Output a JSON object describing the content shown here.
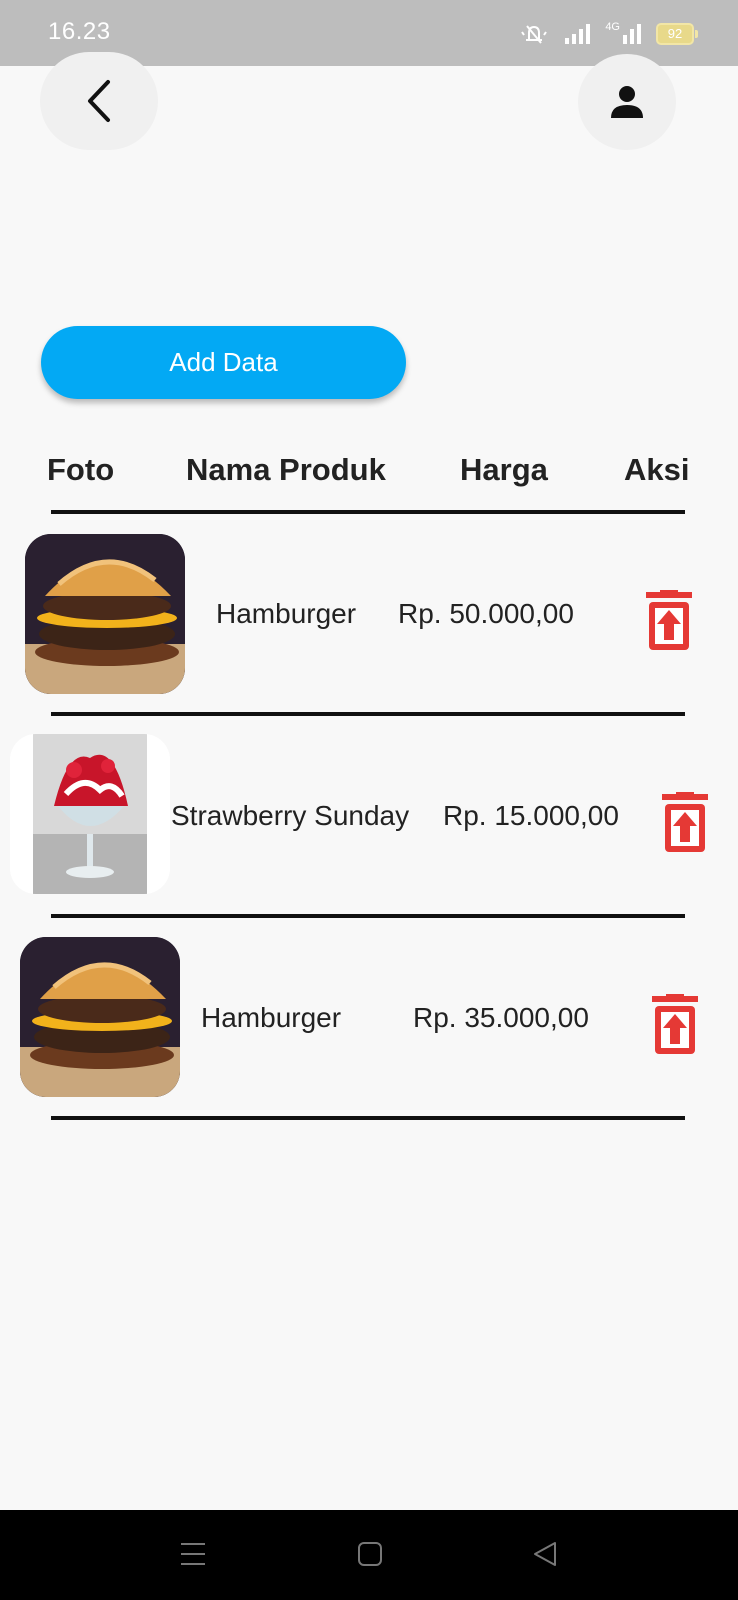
{
  "status_bar": {
    "time": "16.23",
    "battery": "92",
    "network": "4G"
  },
  "header": {
    "back_icon": "chevron-left-icon",
    "profile_icon": "person-icon"
  },
  "actions": {
    "add_label": "Add Data"
  },
  "table": {
    "headers": [
      "Foto",
      "Nama Produk",
      "Harga",
      "Aksi"
    ],
    "rows": [
      {
        "image": "hamburger-photo",
        "name": "Hamburger",
        "price": "Rp. 50.000,00"
      },
      {
        "image": "strawberry-sundae-photo",
        "name": "Strawberry Sunday",
        "price": "Rp. 15.000,00"
      },
      {
        "image": "hamburger-photo",
        "name": "Hamburger",
        "price": "Rp. 35.000,00"
      }
    ]
  },
  "colors": {
    "accent": "#03a9f4",
    "delete": "#e53935",
    "status_bar": "#bdbdbd"
  },
  "nav": {
    "icons": [
      "menu-icon",
      "home-square-icon",
      "back-triangle-icon"
    ]
  }
}
